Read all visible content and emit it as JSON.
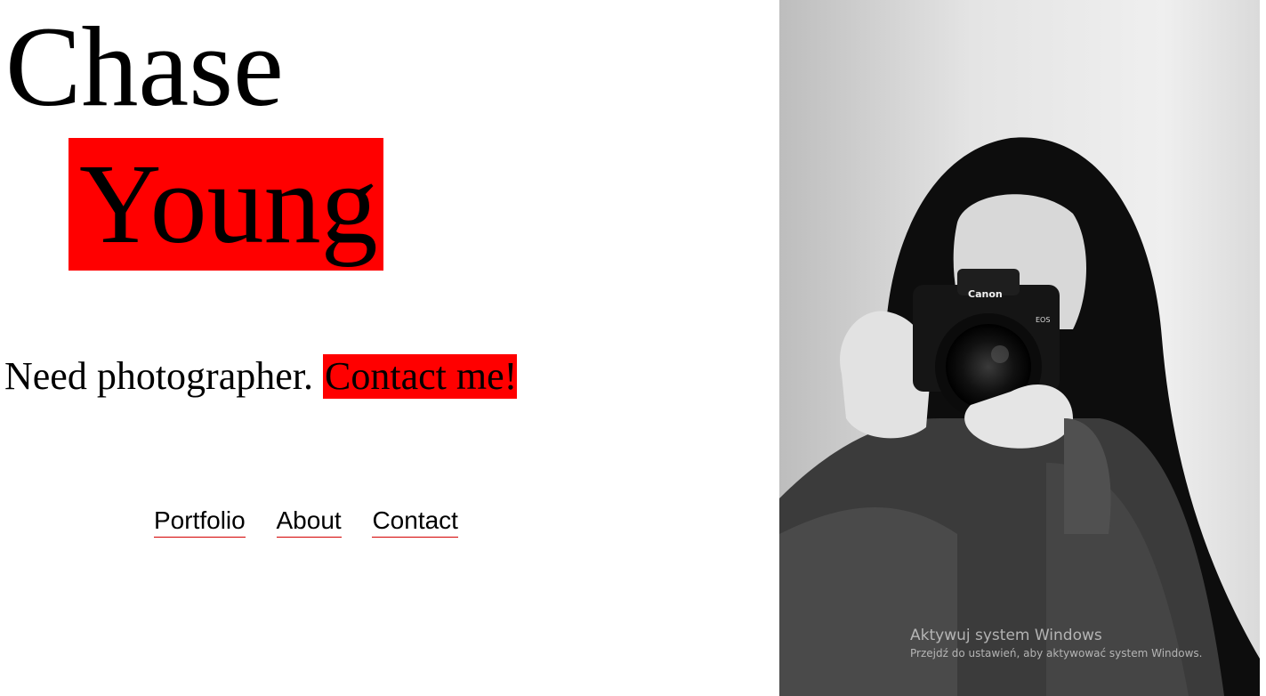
{
  "hero": {
    "first_name": "Chase",
    "last_name": "Young",
    "tagline": "Need photographer.",
    "cta_label": "Contact me!"
  },
  "nav": {
    "items": [
      {
        "label": "Portfolio"
      },
      {
        "label": "About"
      },
      {
        "label": "Contact"
      }
    ]
  },
  "photo": {
    "camera_brand": "Canon",
    "camera_model": "EOS"
  },
  "watermark": {
    "title": "Aktywuj system Windows",
    "subtitle": "Przejdź do ustawień, aby aktywować system Windows."
  },
  "colors": {
    "accent": "#ff0000",
    "text": "#000000",
    "background": "#ffffff"
  }
}
